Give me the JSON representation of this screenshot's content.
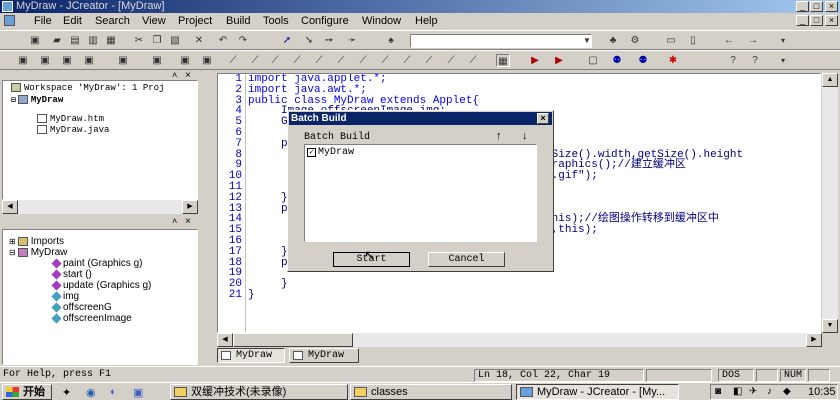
{
  "window": {
    "title": "MyDraw - JCreator - [MyDraw]"
  },
  "menu": [
    "File",
    "Edit",
    "Search",
    "View",
    "Project",
    "Build",
    "Tools",
    "Configure",
    "Window",
    "Help"
  ],
  "workspace": {
    "root": "Workspace 'MyDraw': 1 Proj",
    "project": "MyDraw",
    "files": [
      "MyDraw.htm",
      "MyDraw.java"
    ]
  },
  "classview": {
    "items": [
      {
        "label": "Imports",
        "indent": 0,
        "icon": "package-icon"
      },
      {
        "label": "MyDraw",
        "indent": 0,
        "icon": "class-icon"
      },
      {
        "label": "paint (Graphics g)",
        "indent": 1,
        "icon": "method-icon"
      },
      {
        "label": "start ()",
        "indent": 1,
        "icon": "method-icon"
      },
      {
        "label": "update (Graphics g)",
        "indent": 1,
        "icon": "method-icon"
      },
      {
        "label": "img",
        "indent": 1,
        "icon": "field-icon"
      },
      {
        "label": "offscreenG",
        "indent": 1,
        "icon": "field-icon"
      },
      {
        "label": "offscreenImage",
        "indent": 1,
        "icon": "field-icon"
      }
    ]
  },
  "editor": {
    "line_numbers": [
      "1",
      "2",
      "3",
      "4",
      "5",
      "6",
      "7",
      "8",
      "9",
      "10",
      "11",
      "12",
      "13",
      "14",
      "15",
      "16",
      "17",
      "18",
      "19",
      "20",
      "21"
    ],
    "lines": [
      "import java.applet.*;",
      "import java.awt.*;",
      "public class MyDraw extends Applet{",
      "     Image offscreenImage,img;",
      "     G",
      "",
      "     p",
      "                                             tSize().width,getSize().height",
      "                                             Graphics();//建立缓冲区",
      "                                             1.gif\");",
      "",
      "     }",
      "     p",
      "                                             this);//绘图操作转移到缓冲区中",
      "                                             0,this);",
      "",
      "     }",
      "     p",
      "",
      "     }",
      "}"
    ]
  },
  "tabs": [
    "MyDraw",
    "MyDraw"
  ],
  "dialog": {
    "title": "Batch Build",
    "label": "Batch Build",
    "item": "MyDraw",
    "start": "Start",
    "cancel": "Cancel"
  },
  "status": {
    "help": "For Help, press F1",
    "position": "Ln 18, Col 22, Char 19",
    "dos": "DOS",
    "num": "NUM"
  },
  "taskbar": {
    "start": "开始",
    "tasks": [
      "双缓冲技术(未录像)",
      "classes",
      "MyDraw - JCreator - [My..."
    ],
    "clock": "10:35"
  }
}
